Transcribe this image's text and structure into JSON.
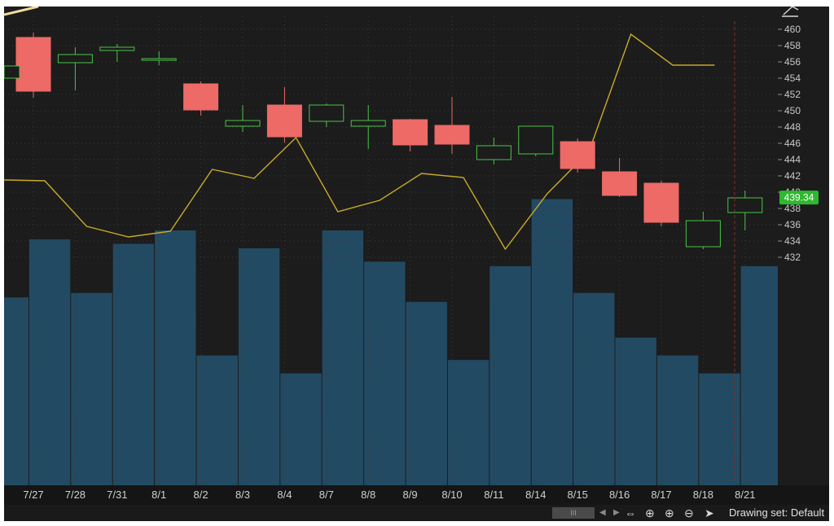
{
  "chart_data": {
    "type": "candlestick",
    "dates": [
      "7/27",
      "7/28",
      "7/31",
      "8/1",
      "8/2",
      "8/3",
      "8/4",
      "8/7",
      "8/8",
      "8/9",
      "8/10",
      "8/11",
      "8/14",
      "8/15",
      "8/16",
      "8/17",
      "8/18",
      "8/21"
    ],
    "candles": [
      {
        "o": 459.0,
        "h": 459.6,
        "l": 451.6,
        "c": 452.4
      },
      {
        "o": 455.9,
        "h": 457.8,
        "l": 452.5,
        "c": 456.9
      },
      {
        "o": 457.4,
        "h": 458.2,
        "l": 456.0,
        "c": 457.8
      },
      {
        "o": 456.2,
        "h": 457.3,
        "l": 455.6,
        "c": 456.4
      },
      {
        "o": 453.3,
        "h": 453.6,
        "l": 449.4,
        "c": 450.1
      },
      {
        "o": 448.1,
        "h": 450.7,
        "l": 447.4,
        "c": 448.8
      },
      {
        "o": 450.7,
        "h": 452.9,
        "l": 446.1,
        "c": 446.8
      },
      {
        "o": 448.7,
        "h": 450.9,
        "l": 448.0,
        "c": 450.7
      },
      {
        "o": 448.1,
        "h": 450.7,
        "l": 445.3,
        "c": 448.8
      },
      {
        "o": 448.9,
        "h": 449.0,
        "l": 445.0,
        "c": 445.8
      },
      {
        "o": 448.2,
        "h": 451.7,
        "l": 444.7,
        "c": 445.9
      },
      {
        "o": 444.0,
        "h": 446.7,
        "l": 443.4,
        "c": 445.7
      },
      {
        "o": 444.7,
        "h": 448.1,
        "l": 444.4,
        "c": 448.1
      },
      {
        "o": 446.2,
        "h": 446.6,
        "l": 442.4,
        "c": 442.9
      },
      {
        "o": 442.5,
        "h": 444.2,
        "l": 439.4,
        "c": 439.6
      },
      {
        "o": 441.1,
        "h": 441.4,
        "l": 435.8,
        "c": 436.3
      },
      {
        "o": 433.3,
        "h": 437.6,
        "l": 433.0,
        "c": 436.5
      },
      {
        "o": 437.5,
        "h": 440.2,
        "l": 435.3,
        "c": 439.3
      }
    ],
    "volume_relative": [
      0.6,
      0.47,
      0.59,
      0.48,
      0.45,
      0.73,
      0.49,
      0.77,
      0.45,
      0.52,
      0.61,
      0.74,
      0.53,
      0.38,
      0.59,
      0.69,
      0.73,
      0.77,
      0.53
    ],
    "study_line_y": [
      441.5,
      441.4,
      435.8,
      434.5,
      435.2,
      442.8,
      441.7,
      446.7,
      437.6,
      439.0,
      442.3,
      441.8,
      433.0,
      439.8,
      445.0,
      459.4,
      455.6,
      455.6
    ],
    "y_ticks": [
      "460",
      "458",
      "456",
      "454",
      "452",
      "450",
      "448",
      "446",
      "444",
      "442",
      "440",
      "438",
      "436",
      "434",
      "432"
    ],
    "ylim": [
      432,
      461
    ],
    "last_price": "439.34",
    "colors": {
      "background": "#1c1c1c",
      "up": "#47c547",
      "down": "#ee6a66",
      "volume": "#234a63",
      "study_line": "#c9aa29",
      "grid": "#3a3a3a",
      "price_label": "#2eb82e"
    },
    "grid": true
  },
  "status_bar": {
    "scroll_handle_label": "III",
    "label": "Drawing set: Default"
  },
  "icons": [
    "scroll-left-icon",
    "scroll-right-icon",
    "horizontal-resize-icon",
    "crosshair-icon",
    "zoom-in-icon",
    "zoom-out-icon",
    "pointer-icon",
    "drawing-tool-icon"
  ]
}
